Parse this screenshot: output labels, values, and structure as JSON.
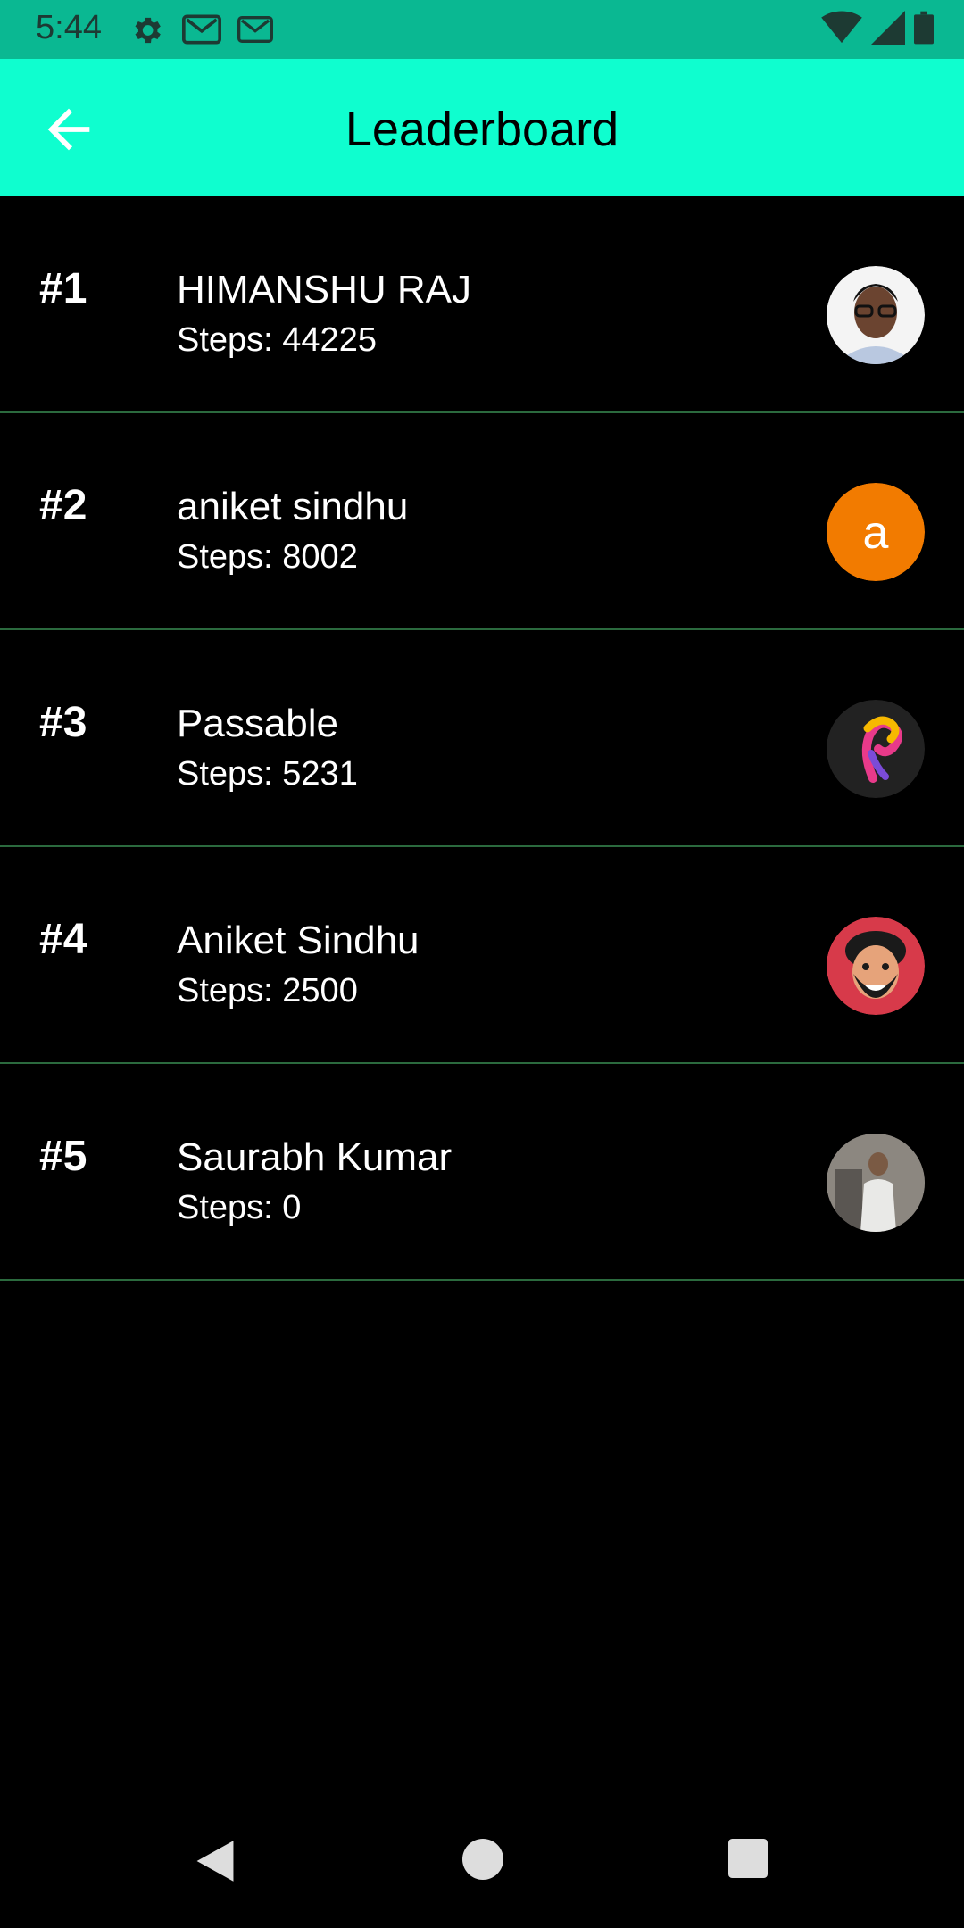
{
  "status_bar": {
    "time": "5:44",
    "icons_left": [
      "gear-icon",
      "gmail-icon",
      "gmail-icon"
    ],
    "icons_right": [
      "wifi-icon",
      "signal-icon",
      "battery-icon"
    ],
    "background": "#0ab892"
  },
  "app_bar": {
    "title": "Leaderboard",
    "back_icon": "arrow-left-icon",
    "background": "#0ffecf"
  },
  "leaderboard": {
    "steps_prefix": "Steps: ",
    "entries": [
      {
        "rank": "#1",
        "name": "HIMANSHU RAJ",
        "steps": "Steps: 44225",
        "avatar": "person-photo-avatar"
      },
      {
        "rank": "#2",
        "name": "aniket sindhu",
        "steps": "Steps: 8002",
        "avatar_letter": "a",
        "avatar_color": "#f27b00"
      },
      {
        "rank": "#3",
        "name": "Passable",
        "steps": "Steps: 5231",
        "avatar": "passable-logo-avatar"
      },
      {
        "rank": "#4",
        "name": "Aniket Sindhu",
        "steps": "Steps: 2500",
        "avatar": "cartoon-face-avatar"
      },
      {
        "rank": "#5",
        "name": "Saurabh Kumar",
        "steps": "Steps: 0",
        "avatar": "person-photo-avatar"
      }
    ],
    "divider_color": "#2b6a3e"
  },
  "nav_bar": {
    "icons": [
      "back-triangle-icon",
      "home-circle-icon",
      "recents-square-icon"
    ]
  }
}
